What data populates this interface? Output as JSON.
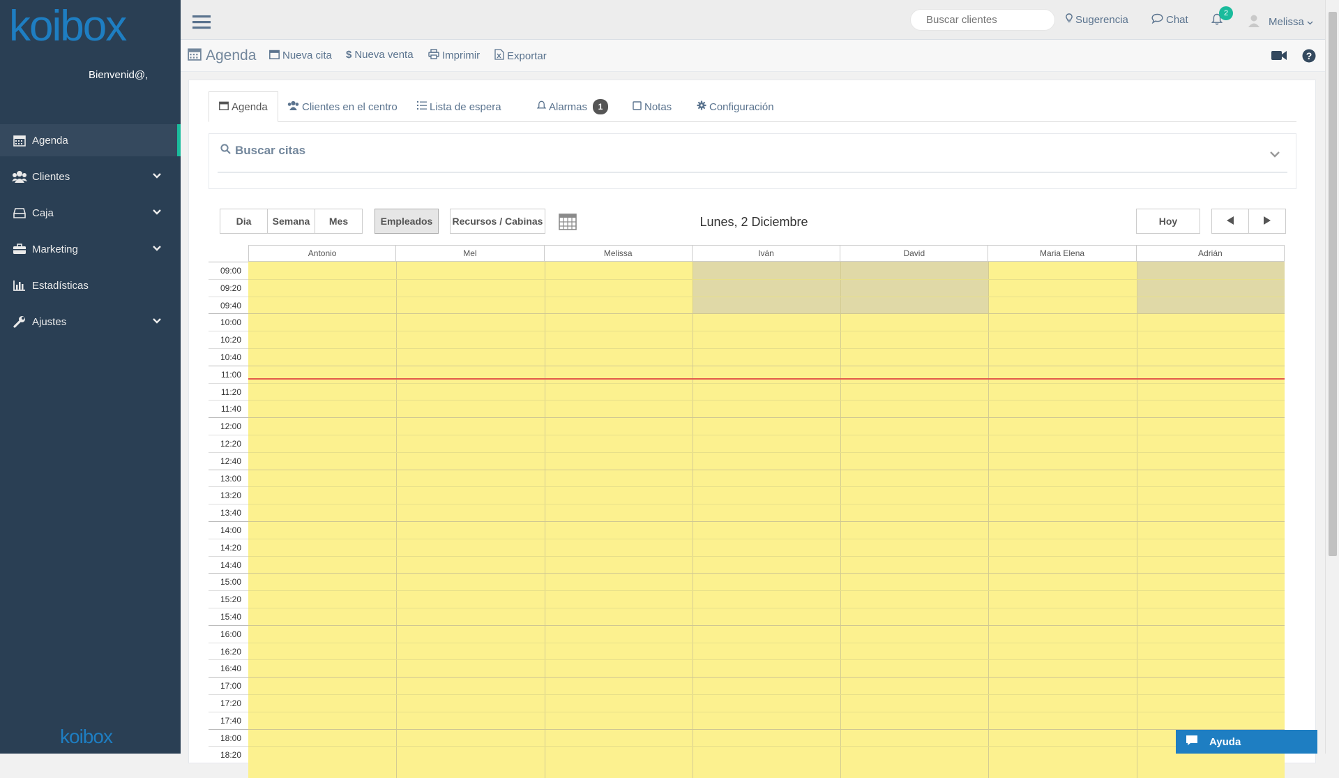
{
  "brand": {
    "logo": "koibox",
    "footer_logo": "koibox"
  },
  "sidebar": {
    "welcome": "Bienvenid@,",
    "items": [
      {
        "label": "Agenda",
        "icon": "calendar-icon",
        "active": true,
        "expandable": false
      },
      {
        "label": "Clientes",
        "icon": "users-icon",
        "active": false,
        "expandable": true
      },
      {
        "label": "Caja",
        "icon": "cash-drawer-icon",
        "active": false,
        "expandable": true
      },
      {
        "label": "Marketing",
        "icon": "briefcase-icon",
        "active": false,
        "expandable": true
      },
      {
        "label": "Estadísticas",
        "icon": "bar-chart-icon",
        "active": false,
        "expandable": false
      },
      {
        "label": "Ajustes",
        "icon": "wrench-icon",
        "active": false,
        "expandable": true
      }
    ]
  },
  "topbar": {
    "search_placeholder": "Buscar clientes",
    "suggestion": "Sugerencia",
    "chat": "Chat",
    "notifications_count": "2",
    "user": "Melissa"
  },
  "toolbar": {
    "title": "Agenda",
    "new_appointment": "Nueva cita",
    "new_sale": "Nueva venta",
    "print": "Imprimir",
    "export": "Exportar"
  },
  "tabs": [
    {
      "label": "Agenda",
      "icon": "calendar-icon",
      "active": true
    },
    {
      "label": "Clientes en el centro",
      "icon": "users-icon",
      "active": false
    },
    {
      "label": "Lista de espera",
      "icon": "list-icon",
      "active": false
    },
    {
      "label": "Alarmas",
      "icon": "bell-icon",
      "active": false,
      "badge": "1"
    },
    {
      "label": "Notas",
      "icon": "note-icon",
      "active": false
    },
    {
      "label": "Configuración",
      "icon": "gear-icon",
      "active": false
    }
  ],
  "search_appointments": {
    "title": "Buscar citas"
  },
  "view_controls": {
    "day": "Dia",
    "week": "Semana",
    "month": "Mes",
    "employees": "Empleados",
    "resources": "Recursos / Cabinas",
    "today": "Hoy",
    "date_title": "Lunes, 2 Diciembre"
  },
  "calendar": {
    "employees": [
      "Antonio",
      "Mel",
      "Melissa",
      "Iván",
      "David",
      "Maria Elena",
      "Adrián"
    ],
    "unavailable_9_to_10": [
      "Iván",
      "David",
      "Adrián"
    ],
    "times": [
      "09:00",
      "09:20",
      "09:40",
      "10:00",
      "10:20",
      "10:40",
      "11:00",
      "11:20",
      "11:40",
      "12:00",
      "12:20",
      "12:40",
      "13:00",
      "13:20",
      "13:40",
      "14:00",
      "14:20",
      "14:40",
      "15:00",
      "15:20",
      "15:40",
      "16:00",
      "16:20",
      "16:40",
      "17:00",
      "17:20",
      "17:40",
      "18:00",
      "18:20"
    ],
    "current_time_marker": "11:15",
    "colors": {
      "available": "#fcf18f",
      "unavailable": "#e0d9a7",
      "now_line": "#e25a4a"
    }
  },
  "help_widget": {
    "label": "Ayuda"
  }
}
